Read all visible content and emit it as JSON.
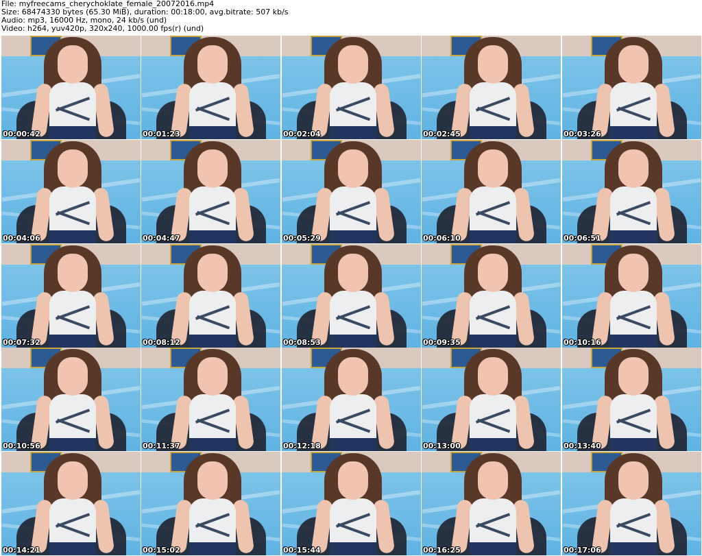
{
  "info": {
    "file": "File: myfreecams_cherychoklate_female_20072016.mp4",
    "size": "Size: 68474330 bytes (65.30 MiB), duration: 00:18:00, avg.bitrate: 507 kb/s",
    "audio": "Audio: mp3, 16000 Hz, mono, 24 kb/s (und)",
    "video": "Video: h264, yuv420p, 320x240, 1000.00 fps(r) (und)"
  },
  "timestamps": [
    "00:00:42",
    "00:01:23",
    "00:02:04",
    "00:02:45",
    "00:03:26",
    "00:04:06",
    "00:04:47",
    "00:05:29",
    "00:06:10",
    "00:06:51",
    "00:07:32",
    "00:08:12",
    "00:08:53",
    "00:09:35",
    "00:10:16",
    "00:10:56",
    "00:11:37",
    "00:12:18",
    "00:13:00",
    "00:13:40",
    "00:14:21",
    "00:15:02",
    "00:15:44",
    "00:16:25",
    "00:17:06"
  ]
}
